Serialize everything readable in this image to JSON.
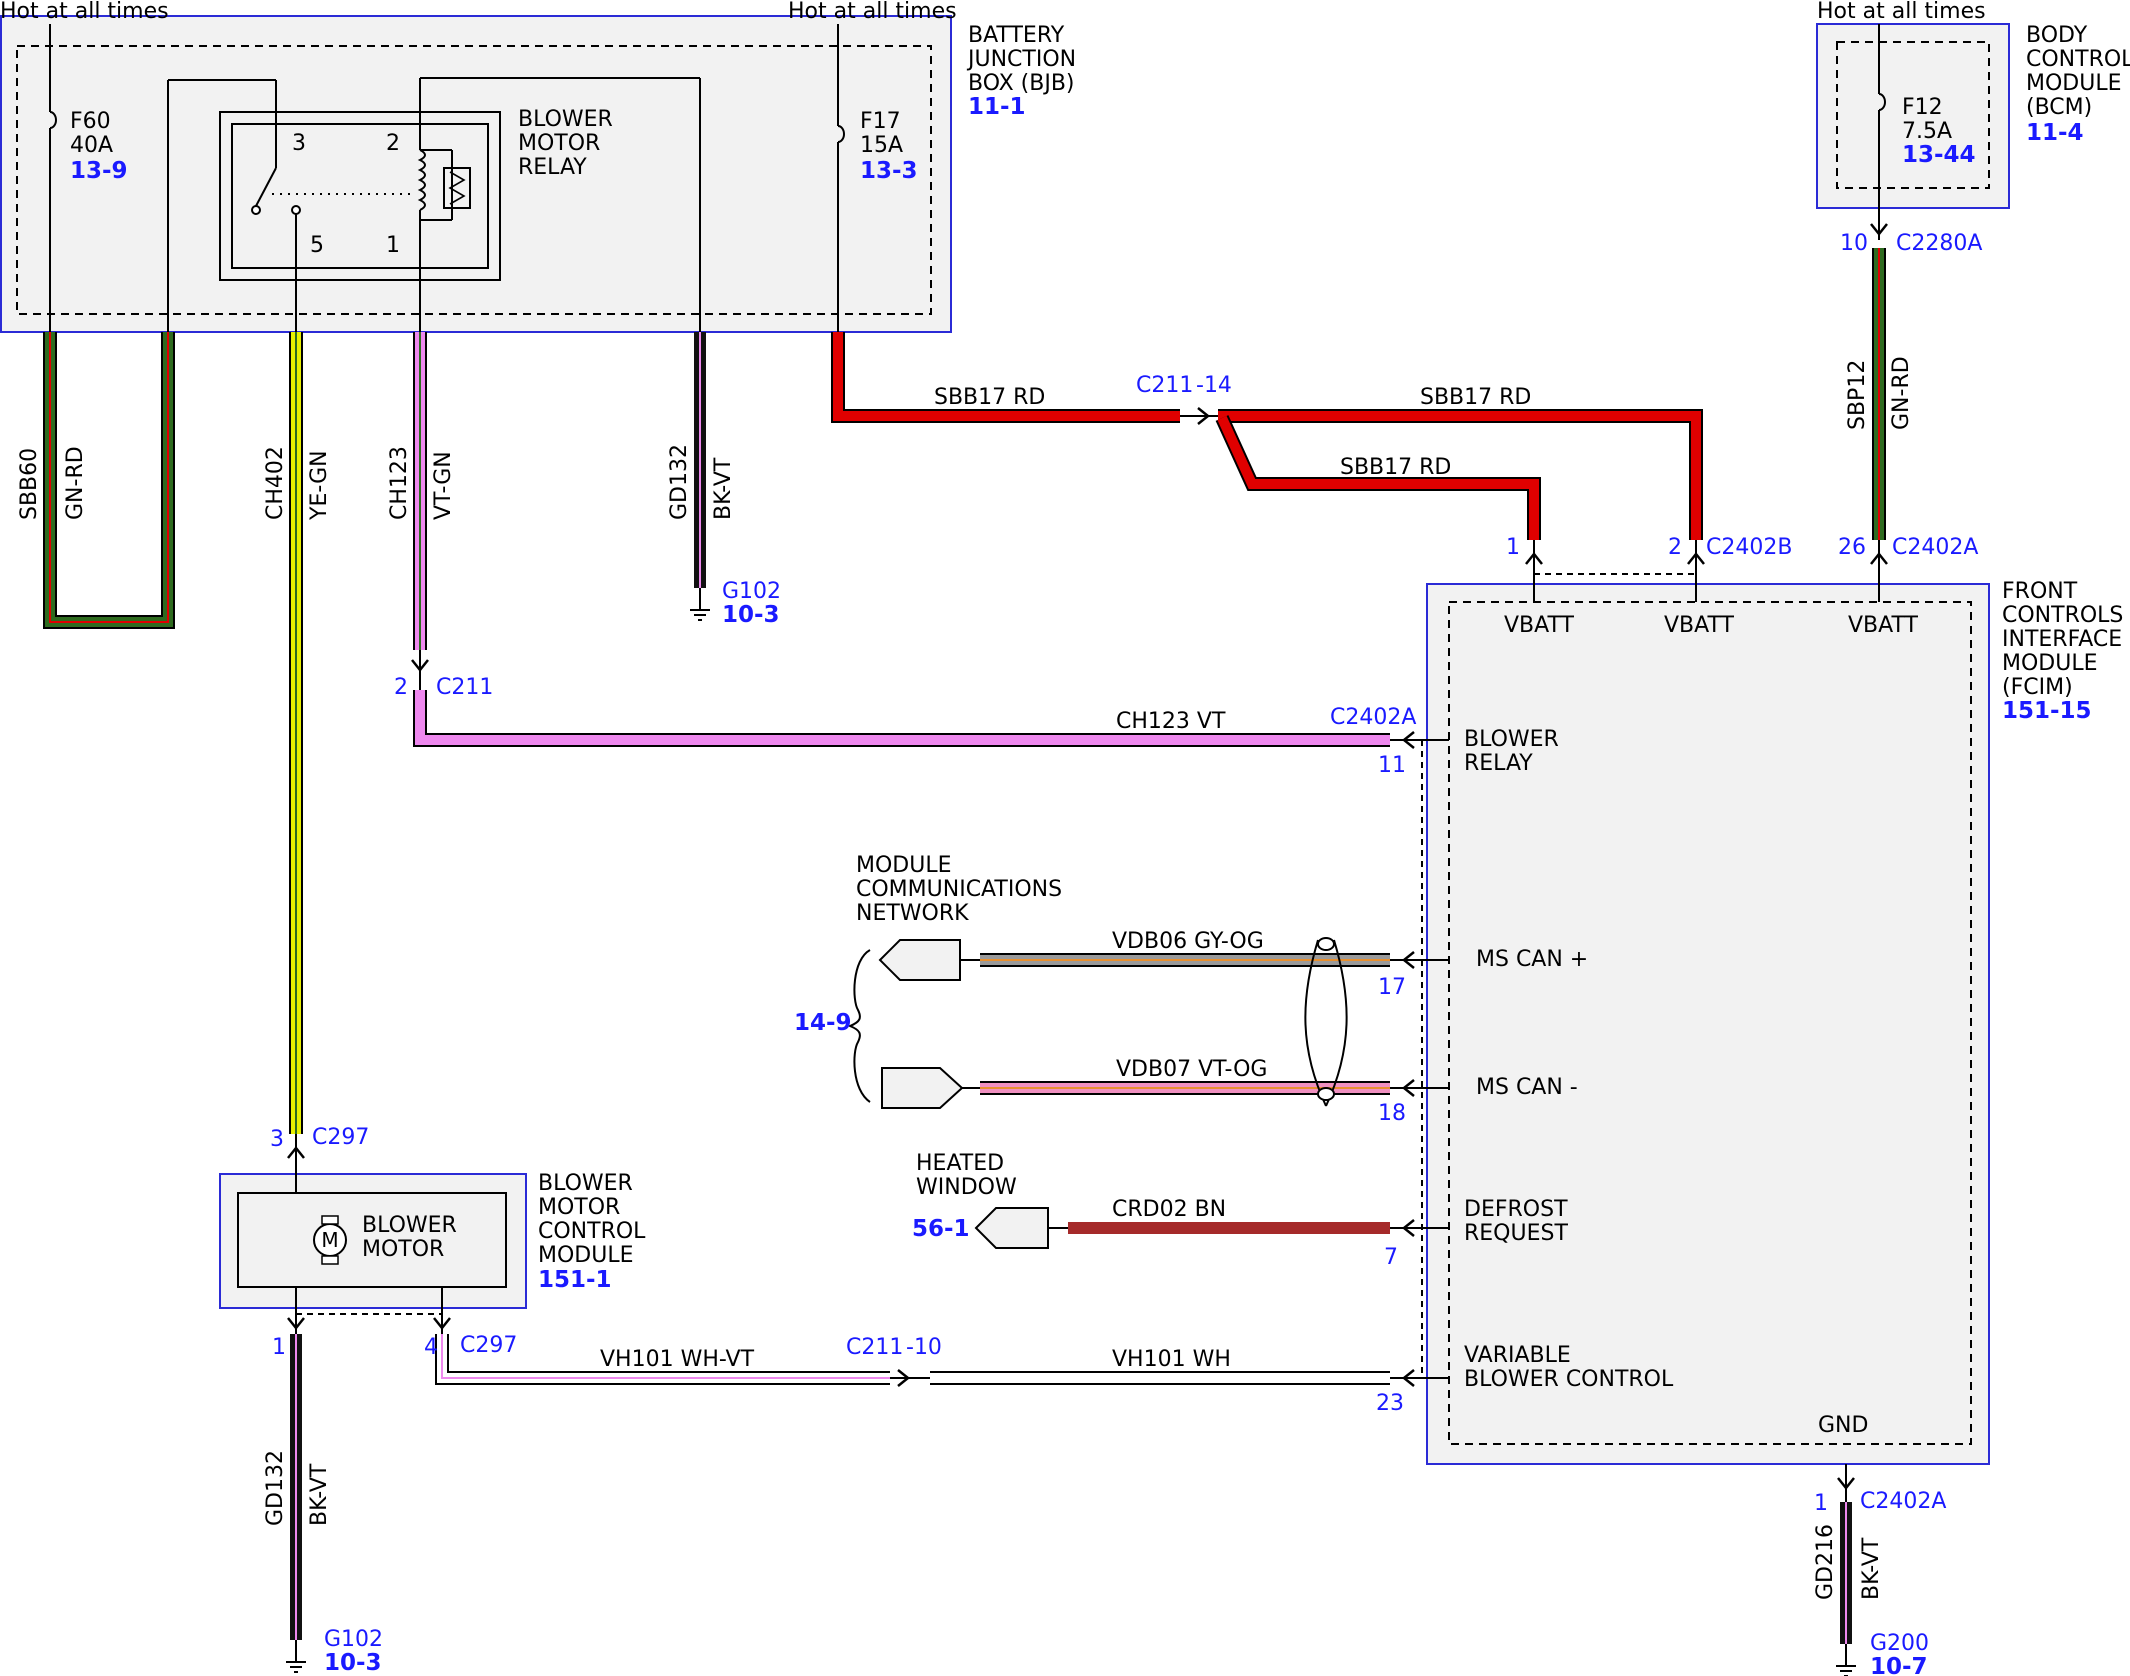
{
  "colors": {
    "box_border": "#2b2bd6",
    "box_fill": "#f2f2f2",
    "ref_text": "#1a1aff",
    "red": "#e00000",
    "green": "#2e6b1f",
    "yellow": "#e8f000",
    "violet": "#ee88ee",
    "white": "#ffffff",
    "black": "#111111",
    "pink": "#f090c0",
    "brown": "#a52a2a",
    "orange": "#e89030",
    "gray": "#9a9a9a"
  },
  "labels": {
    "hot_at_all_times": "Hot at all times",
    "bjb_line1": "BATTERY",
    "bjb_line2": "JUNCTION",
    "bjb_line3": "BOX (BJB)",
    "bjb_ref": "11-1",
    "bcm_line1": "BODY",
    "bcm_line2": "CONTROL",
    "bcm_line3": "MODULE",
    "bcm_line4": "(BCM)",
    "bcm_ref": "11-4",
    "fcim_line1": "FRONT",
    "fcim_line2": "CONTROLS",
    "fcim_line3": "INTERFACE",
    "fcim_line4": "MODULE",
    "fcim_line5": "(FCIM)",
    "fcim_ref": "151-15",
    "bmcm_line1": "BLOWER",
    "bmcm_line2": "MOTOR",
    "bmcm_line3": "CONTROL",
    "bmcm_line4": "MODULE",
    "bmcm_ref": "151-1",
    "motor_line1": "BLOWER",
    "motor_line2": "MOTOR",
    "relay_line1": "BLOWER",
    "relay_line2": "MOTOR",
    "relay_line3": "RELAY",
    "relay_pin3": "3",
    "relay_pin2": "2",
    "relay_pin5": "5",
    "relay_pin1": "1",
    "f60_name": "F60",
    "f60_amp": "40A",
    "f60_ref": "13-9",
    "f17_name": "F17",
    "f17_amp": "15A",
    "f17_ref": "13-3",
    "f12_name": "F12",
    "f12_amp": "7.5A",
    "f12_ref": "13-44",
    "vbatt": "VBATT",
    "blower_relay_1": "BLOWER",
    "blower_relay_2": "RELAY",
    "ms_can_plus": "MS CAN +",
    "ms_can_minus": "MS CAN -",
    "defrost_1": "DEFROST",
    "defrost_2": "REQUEST",
    "vbc_1": "VARIABLE",
    "vbc_2": "BLOWER CONTROL",
    "gnd": "GND",
    "mcn_1": "MODULE",
    "mcn_2": "COMMUNICATIONS",
    "mcn_3": "NETWORK",
    "mcn_ref": "14-9",
    "hw_1": "HEATED",
    "hw_2": "WINDOW",
    "hw_ref": "56-1",
    "g102": "G102",
    "g102_ref": "10-3",
    "g200": "G200",
    "g200_ref": "10-7"
  },
  "wires": {
    "sbb60_code": "SBB60",
    "sbb60_color": "GN-RD",
    "ch402_code": "CH402",
    "ch402_color": "YE-GN",
    "ch123_code": "CH123",
    "ch123_color": "VT-GN",
    "gd132_code": "GD132",
    "gd132_color": "BK-VT",
    "sbb17_a": "SBB17  RD",
    "sbb17_b": "SBB17  RD",
    "sbb17_c": "SBB17  RD",
    "sbp12_code": "SBP12",
    "sbp12_color": "GN-RD",
    "ch123_vt": "CH123  VT",
    "vdb06": "VDB06  GY-OG",
    "vdb07": "VDB07  VT-OG",
    "crd02": "CRD02  BN",
    "vh101_whvt": "VH101    WH-VT",
    "vh101_wh": "VH101    WH",
    "gd132b_code": "GD132",
    "gd132b_color": "BK-VT",
    "gd216_code": "GD216",
    "gd216_color": "BK-VT"
  },
  "connectors": {
    "c211_14": "C211",
    "c211_14_pin": "-14",
    "c211_2": "C211",
    "c211_2_pin": "2",
    "c211_10": "C211",
    "c211_10_pin": "-10",
    "c2402b": "C2402B",
    "c2402b_pin": "2",
    "c2402b_pin_1": "1",
    "c2402a_top": "C2402A",
    "c2402a_top_pin": "26",
    "c2280a": "C2280A",
    "c2280a_pin": "10",
    "c2402a_11": "C2402A",
    "c2402a_11_pin": "11",
    "pin17": "17",
    "pin18": "18",
    "pin7": "7",
    "pin23": "23",
    "c297_top": "C297",
    "c297_top_pin": "3",
    "c297_bot": "C297",
    "c297_bot_pin1": "1",
    "c297_bot_pin4": "4",
    "c2402a_gnd": "C2402A",
    "c2402a_gnd_pin": "1"
  }
}
